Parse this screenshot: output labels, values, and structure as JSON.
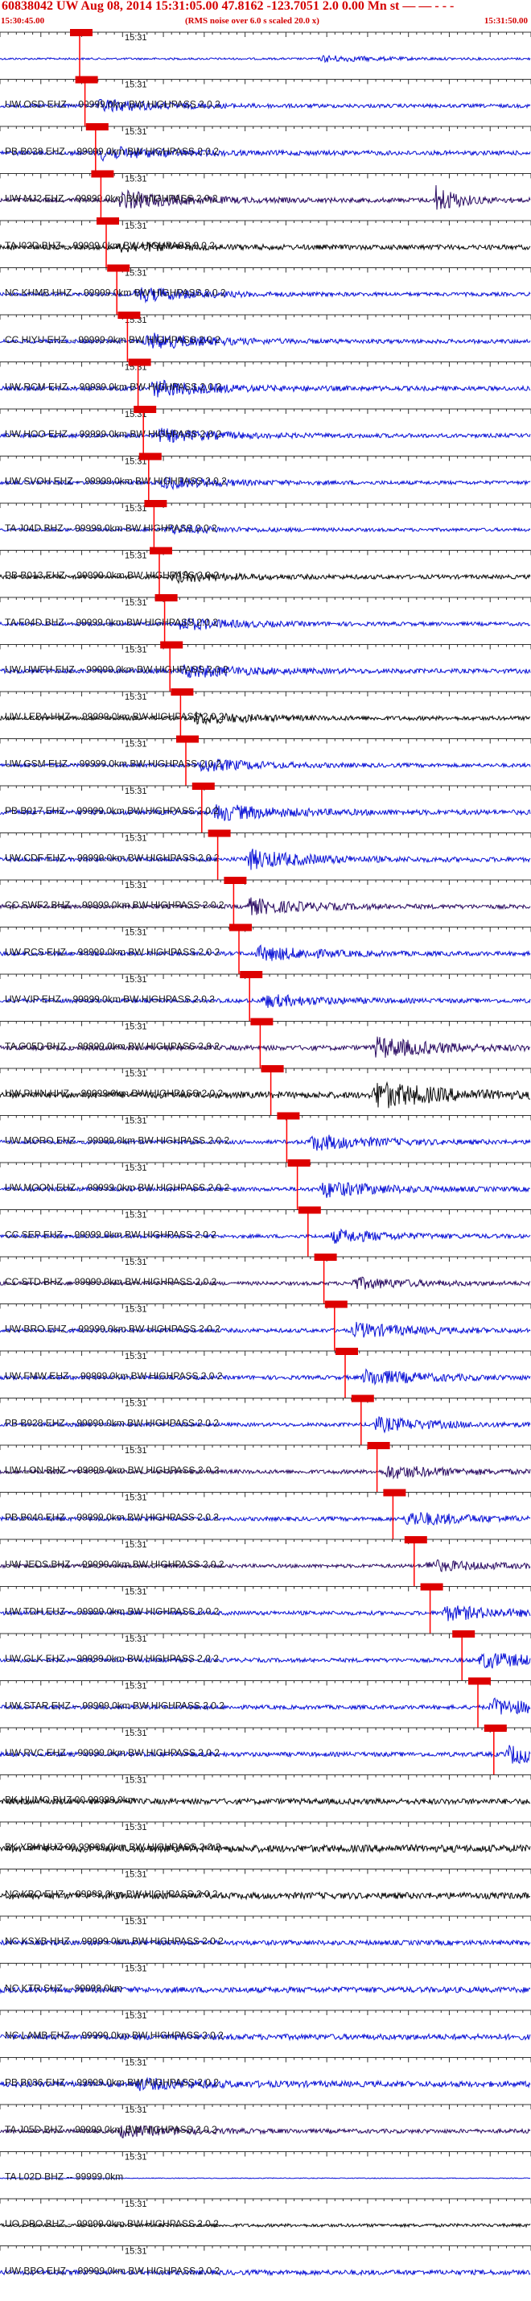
{
  "header": {
    "title": "60838042 UW Aug 08, 2014 15:31:05.00   47.8162 -123.7051  2.0 0.00 Mn st — — - - -",
    "start_time": "15:30:45.00",
    "note": "(RMS noise over 6.0 s scaled 20.0 x)",
    "end_time": "15:31:50.00"
  },
  "time_tick_label": "15:31",
  "colors": {
    "blue": "#0b12d6",
    "black": "#0a0a0a",
    "purple": "#2b0c63",
    "red": "#ff0000",
    "pick_box": "#dd0000"
  },
  "traces": [
    {
      "label": "",
      "color": "blue",
      "amp": 0.25,
      "burst": 0.8,
      "burst_at": 0.6,
      "pick": 0.15
    },
    {
      "label": "UW OSD EHZ -- 99999.0km BW  HIGHPASS  2.0  2",
      "color": "blue",
      "amp": 0.45,
      "burst": 1.6,
      "burst_at": 0.18,
      "pick": 0.16
    },
    {
      "label": "PB B038 EHZ -- 99999.0km BW  HIGHPASS  2.0  2",
      "color": "blue",
      "amp": 0.55,
      "burst": 1.6,
      "burst_at": 0.18,
      "pick": 0.18
    },
    {
      "label": "UW MJ2 EHZ -- 99999.0km BW  HIGHPASS  2.0  2",
      "color": "purple",
      "amp": 0.55,
      "burst": 2.2,
      "burst_at": 0.22,
      "pick": 0.19,
      "burst2": 3.5,
      "burst2_at": 0.82
    },
    {
      "label": "TA I02D BHZ -- 99999.0km BW  HIGHPASS  2.0  2",
      "color": "black",
      "amp": 0.6,
      "burst": 1.0,
      "burst_at": 0.22,
      "pick": 0.2
    },
    {
      "label": "NC KHMB HHZ -- 99999.0km BW  HIGHPASS  2.0  2",
      "color": "blue",
      "amp": 0.45,
      "burst": 1.8,
      "burst_at": 0.25,
      "pick": 0.22
    },
    {
      "label": "CC HIYU EHZ -- 99999.0km BW  HIGHPASS  2.0  2",
      "color": "blue",
      "amp": 0.5,
      "burst": 2.0,
      "burst_at": 0.27,
      "pick": 0.24
    },
    {
      "label": "UW RCM EHZ -- 99999.0km BW  HIGHPASS  2.0  2",
      "color": "blue",
      "amp": 0.55,
      "burst": 2.0,
      "burst_at": 0.28,
      "pick": 0.26
    },
    {
      "label": "UW HOO EHZ -- 99999.0km BW  HIGHPASS  2.0  2",
      "color": "blue",
      "amp": 0.5,
      "burst": 1.6,
      "burst_at": 0.29,
      "pick": 0.27
    },
    {
      "label": "UW SVOH EHZ -- 99999.0km BW  HIGHPASS  2.0  2",
      "color": "blue",
      "amp": 0.45,
      "burst": 1.4,
      "burst_at": 0.3,
      "pick": 0.28
    },
    {
      "label": "TA J04D BHZ -- 99999.0km BW  HIGHPASS  2.0  2",
      "color": "blue",
      "amp": 0.4,
      "burst": 1.0,
      "burst_at": 0.31,
      "pick": 0.29
    },
    {
      "label": "PB B013 EHZ -- 99999.0km BW  HIGHPASS  2.0  2",
      "color": "black",
      "amp": 0.5,
      "burst": 1.2,
      "burst_at": 0.32,
      "pick": 0.3
    },
    {
      "label": "TA F04D BHZ -- 99999.0km BW  HIGHPASS  2.0  2",
      "color": "blue",
      "amp": 0.45,
      "burst": 1.5,
      "burst_at": 0.33,
      "pick": 0.31
    },
    {
      "label": "UW UWFH EHZ -- 99999.0km BW  HIGHPASS  2.0  2",
      "color": "blue",
      "amp": 0.55,
      "burst": 1.6,
      "burst_at": 0.34,
      "pick": 0.32
    },
    {
      "label": "UW LEBA HHZ -- 99999.0km BW  HIGHPASS  2.0  2",
      "color": "black",
      "amp": 0.5,
      "burst": 1.4,
      "burst_at": 0.36,
      "pick": 0.34
    },
    {
      "label": "UW GSM EHZ -- 99999.0km BW  HIGHPASS  2.0  2",
      "color": "blue",
      "amp": 0.45,
      "burst": 1.6,
      "burst_at": 0.37,
      "pick": 0.35
    },
    {
      "label": "PB B017 EHZ -- 99999.0km BW  HIGHPASS  2.0  2",
      "color": "blue",
      "amp": 0.6,
      "burst": 2.0,
      "burst_at": 0.4,
      "pick": 0.38
    },
    {
      "label": "UW CDF EHZ -- 99999.0km BW  HIGHPASS  2.0  2",
      "color": "blue",
      "amp": 0.55,
      "burst": 2.4,
      "burst_at": 0.46,
      "pick": 0.41
    },
    {
      "label": "CC SWF2 BHZ -- 99999.0km BW  HIGHPASS  2.0  2",
      "color": "purple",
      "amp": 0.5,
      "burst": 2.0,
      "burst_at": 0.46,
      "pick": 0.44
    },
    {
      "label": "UW RCS EHZ -- 99999.0km BW  HIGHPASS  2.0  2",
      "color": "blue",
      "amp": 0.5,
      "burst": 1.8,
      "burst_at": 0.48,
      "pick": 0.45
    },
    {
      "label": "UW VIP EHZ -- 99999.0km BW  HIGHPASS  2.0  2",
      "color": "blue",
      "amp": 0.5,
      "burst": 1.5,
      "burst_at": 0.49,
      "pick": 0.47
    },
    {
      "label": "TA G05D BHZ -- 99999.0km BW  HIGHPASS  2.0  2",
      "color": "purple",
      "amp": 0.6,
      "burst": 2.6,
      "burst_at": 0.7,
      "pick": 0.49
    },
    {
      "label": "UW PHIN HHZ -- 99999.0km BW  HIGHPASS  2.0  2",
      "color": "black",
      "amp": 0.8,
      "burst": 3.4,
      "burst_at": 0.7,
      "pick": 0.51
    },
    {
      "label": "UW MORO EHZ -- 99999.0km BW  HIGHPASS  2.0  2",
      "color": "blue",
      "amp": 0.5,
      "burst": 2.0,
      "burst_at": 0.58,
      "pick": 0.54
    },
    {
      "label": "UW MOON EHZ -- 99999.0km BW  HIGHPASS  2.0  2",
      "color": "blue",
      "amp": 0.5,
      "burst": 2.0,
      "burst_at": 0.6,
      "pick": 0.56
    },
    {
      "label": "CC SEP EHZ -- 99999.0km BW  HIGHPASS  2.0  2",
      "color": "blue",
      "amp": 0.45,
      "burst": 1.6,
      "burst_at": 0.62,
      "pick": 0.58
    },
    {
      "label": "CC STD BHZ -- 99999.0km BW  HIGHPASS  2.0  2",
      "color": "purple",
      "amp": 0.45,
      "burst": 1.4,
      "burst_at": 0.66,
      "pick": 0.61
    },
    {
      "label": "UW BRO EHZ -- 99999.0km BW  HIGHPASS  2.0  2",
      "color": "blue",
      "amp": 0.5,
      "burst": 1.8,
      "burst_at": 0.66,
      "pick": 0.63
    },
    {
      "label": "UW FMW EHZ -- 99999.0km BW  HIGHPASS  2.0  2",
      "color": "blue",
      "amp": 0.5,
      "burst": 2.0,
      "burst_at": 0.68,
      "pick": 0.65
    },
    {
      "label": "PB B928 EHZ -- 99999.0km BW  HIGHPASS  2.0  2",
      "color": "blue",
      "amp": 0.45,
      "burst": 1.8,
      "burst_at": 0.7,
      "pick": 0.68
    },
    {
      "label": "UW LON BHZ -- 99999.0km BW  HIGHPASS  2.0  2",
      "color": "purple",
      "amp": 0.5,
      "burst": 1.6,
      "burst_at": 0.72,
      "pick": 0.71
    },
    {
      "label": "PB B040 EHZ -- 99999.0km BW  HIGHPASS  2.0  2",
      "color": "blue",
      "amp": 0.5,
      "burst": 1.8,
      "burst_at": 0.76,
      "pick": 0.74
    },
    {
      "label": "UW JEDS BHZ -- 99999.0km BW  HIGHPASS  2.0  2",
      "color": "purple",
      "amp": 0.45,
      "burst": 1.4,
      "burst_at": 0.8,
      "pick": 0.78
    },
    {
      "label": "UW TDH EHZ -- 99999.0km BW  HIGHPASS  2.0  2",
      "color": "blue",
      "amp": 0.5,
      "burst": 1.8,
      "burst_at": 0.83,
      "pick": 0.81
    },
    {
      "label": "UW GLK EHZ -- 99999.0km BW  HIGHPASS  2.0  2",
      "color": "blue",
      "amp": 0.5,
      "burst": 2.0,
      "burst_at": 0.9,
      "pick": 0.87
    },
    {
      "label": "UW STAR EHZ -- 99999.0km BW  HIGHPASS  2.0  2",
      "color": "blue",
      "amp": 0.5,
      "burst": 2.0,
      "burst_at": 0.92,
      "pick": 0.9
    },
    {
      "label": "UW RVC EHZ -- 99999.0km BW  HIGHPASS  2.0  2",
      "color": "blue",
      "amp": 0.55,
      "burst": 2.2,
      "burst_at": 0.95,
      "pick": 0.93
    },
    {
      "label": "BK HUMO BHZ 00 99999.0km",
      "color": "black",
      "amp": 0.7,
      "burst": 0,
      "burst_at": 0
    },
    {
      "label": "BK YBH HHZ 00 99999.0km BW  HIGHPASS  2.0  2",
      "color": "black",
      "amp": 0.9,
      "burst": 0,
      "burst_at": 0
    },
    {
      "label": "NC KBO EHZ -- 99999.0km BW  HIGHPASS  2.0  2",
      "color": "black",
      "amp": 0.8,
      "burst": 0,
      "burst_at": 0
    },
    {
      "label": "NC KSXB HHZ -- 99999.0km BW  HIGHPASS  2.0  2",
      "color": "blue",
      "amp": 0.6,
      "burst": 0,
      "burst_at": 0
    },
    {
      "label": "NC KTR SHZ -- 99999.0km",
      "color": "blue",
      "amp": 0.7,
      "burst": 0,
      "burst_at": 0
    },
    {
      "label": "NC LAMB EHZ -- 99999.0km BW  HIGHPASS  2.0  2",
      "color": "blue",
      "amp": 0.7,
      "burst": 0,
      "burst_at": 0
    },
    {
      "label": "PB B036 EHZ -- 99999.0km BW  HIGHPASS  2.0  2",
      "color": "blue",
      "amp": 0.7,
      "burst": 1.2,
      "burst_at": 0.25
    },
    {
      "label": "TA J05D BHZ -- 99999.0km BW  HIGHPASS  2.0  2",
      "color": "purple",
      "amp": 0.5,
      "burst": 1.3,
      "burst_at": 0.22
    },
    {
      "label": "TA L02D BHZ -- 99999.0km",
      "color": "blue",
      "amp": 0.1,
      "burst": 0,
      "burst_at": 0
    },
    {
      "label": "UO DBO BHZ -- 99999.0km BW  HIGHPASS  2.0  2",
      "color": "black",
      "amp": 0.4,
      "burst": 0,
      "burst_at": 0
    },
    {
      "label": "UW BBO EHZ -- 99999.0km BW  HIGHPASS  2.0  2",
      "color": "blue",
      "amp": 0.6,
      "burst": 0,
      "burst_at": 0
    }
  ]
}
